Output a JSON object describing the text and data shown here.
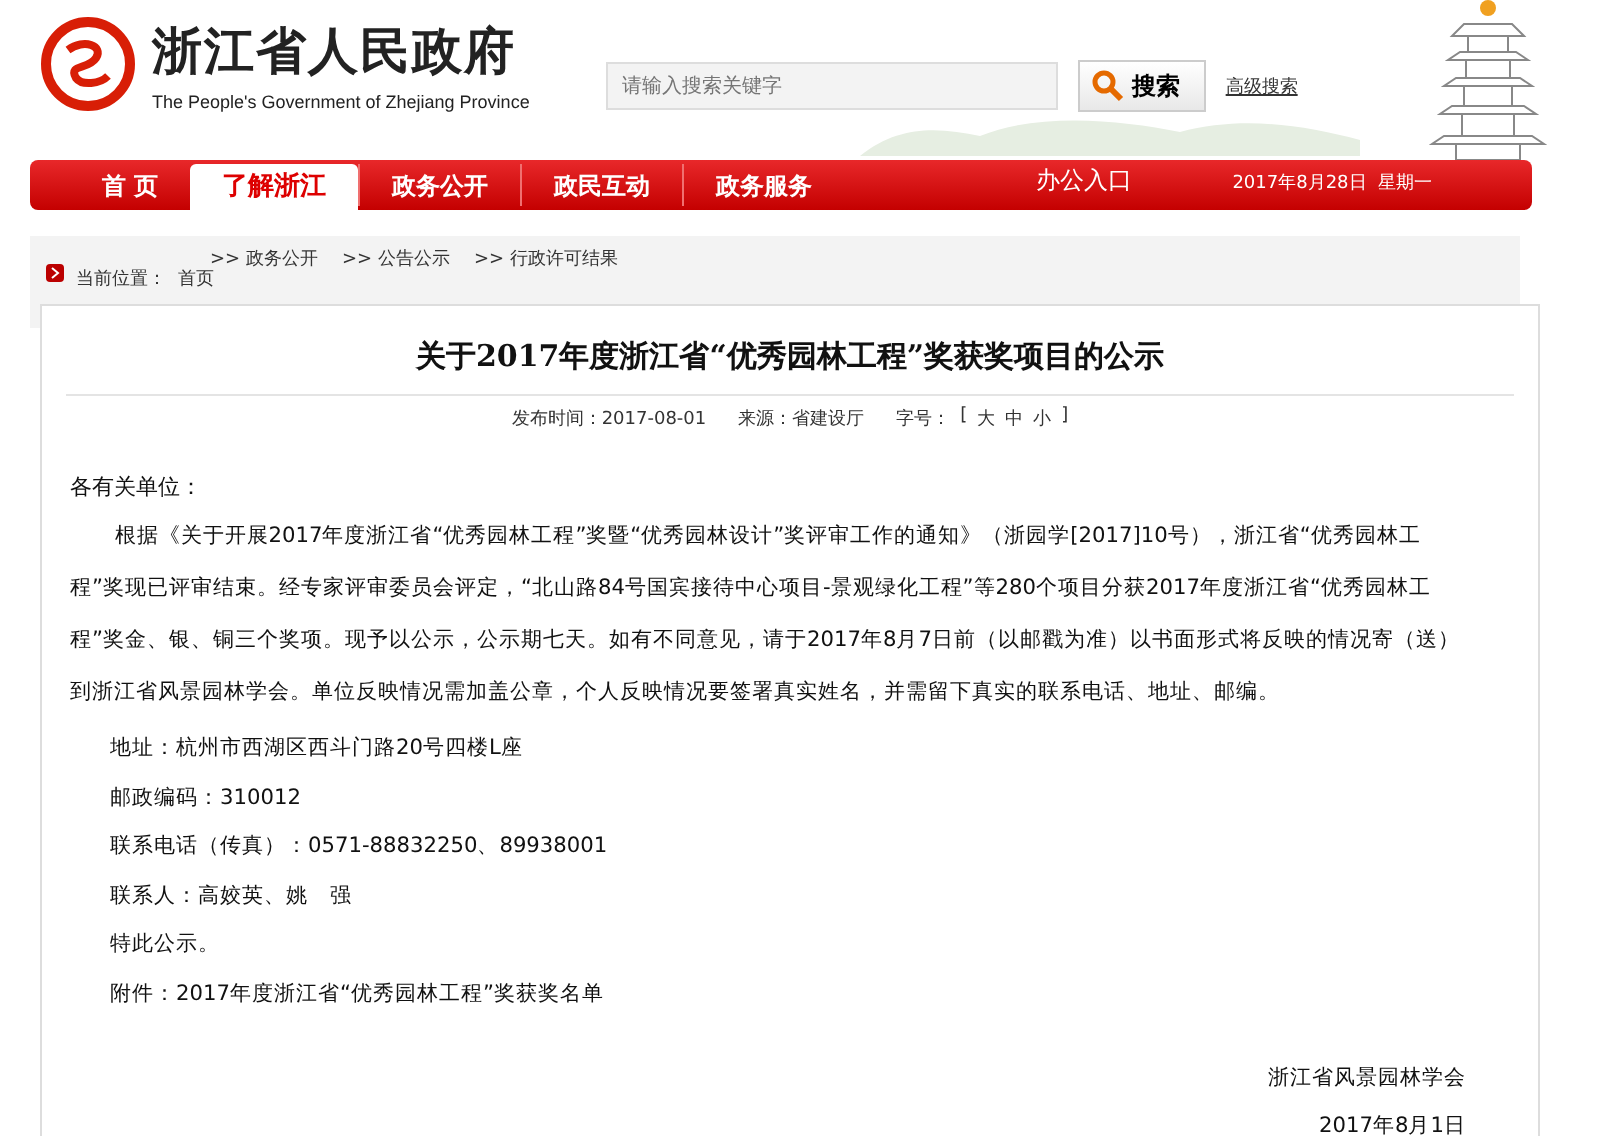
{
  "header": {
    "site_title": "浙江省人民政府",
    "site_subtitle": "The People's Government of Zhejiang Province",
    "search": {
      "placeholder": "请输入搜索关键字",
      "button": "搜索",
      "advanced_link": "高级搜索"
    }
  },
  "nav": {
    "items": [
      {
        "label": "首 页",
        "selected": false
      },
      {
        "label": "了解浙江",
        "selected": true
      },
      {
        "label": "政务公开",
        "selected": false
      },
      {
        "label": "政民互动",
        "selected": false
      },
      {
        "label": "政务服务",
        "selected": false
      }
    ],
    "office_link": "办公入口",
    "date": "2017年8月28日  星期一"
  },
  "breadcrumb": {
    "label": "当前位置：",
    "separator": ">>",
    "items": [
      "首页",
      "政务公开",
      "公告公示",
      "行政许可结果"
    ]
  },
  "article": {
    "title": "关于2017年度浙江省“优秀园林工程”奖获奖项目的公示",
    "meta": {
      "published": "发布时间：2017-08-01",
      "source": "来源：省建设厅",
      "font_size_label": "字号：",
      "brackets": [
        "[",
        "]"
      ],
      "font_sizes": [
        "大",
        "中",
        "小"
      ]
    },
    "salutation": "各有关单位：",
    "body": "根据《关于开展2017年度浙江省“优秀园林工程”奖暨“优秀园林设计”奖评审工作的通知》（浙园学[2017]10号），浙江省“优秀园林工程”奖现已评审结束。经专家评审委员会评定，“北山路84号国宾接待中心项目-景观绿化工程”等280个项目分获2017年度浙江省“优秀园林工程”奖金、银、铜三个奖项。现予以公示，公示期七天。如有不同意见，请于2017年8月7日前（以邮戳为准）以书面形式将反映的情况寄（送）到浙江省风景园林学会。单位反映情况需加盖公章，个人反映情况要签署真实姓名，并需留下真实的联系电话、地址、邮编。",
    "details": [
      "地址：杭州市西湖区西斗门路20号四楼L座",
      "邮政编码：310012",
      "联系电话（传真）：0571-88832250、89938001",
      "联系人：高姣英、姚　强",
      "特此公示。",
      "附件：2017年度浙江省“优秀园林工程”奖获奖名单"
    ],
    "signature": "浙江省风景园林学会",
    "sign_date": "2017年8月1日"
  }
}
